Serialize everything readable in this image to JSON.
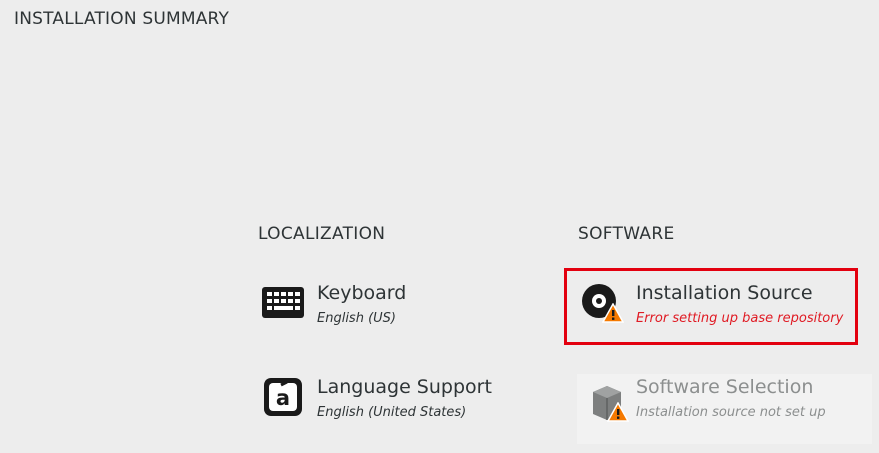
{
  "header": {
    "title": "INSTALLATION SUMMARY"
  },
  "sections": {
    "localization": {
      "heading": "LOCALIZATION",
      "keyboard": {
        "title": "Keyboard",
        "status": "English (US)",
        "icon": "keyboard-icon"
      },
      "language": {
        "title": "Language Support",
        "status": "English (United States)",
        "icon": "language-icon"
      }
    },
    "software": {
      "heading": "SOFTWARE",
      "installation_source": {
        "title": "Installation Source",
        "status": "Error setting up base repository",
        "icon": "disc-icon",
        "warning": true
      },
      "software_selection": {
        "title": "Software Selection",
        "status": "Installation source not set up",
        "icon": "package-icon",
        "warning": true,
        "disabled": true
      }
    }
  },
  "colors": {
    "background": "#ededed",
    "error_text": "#e01b24",
    "warning": "#f57900",
    "highlight_box": "#e3000f",
    "disabled_text": "#8c8f8f"
  }
}
